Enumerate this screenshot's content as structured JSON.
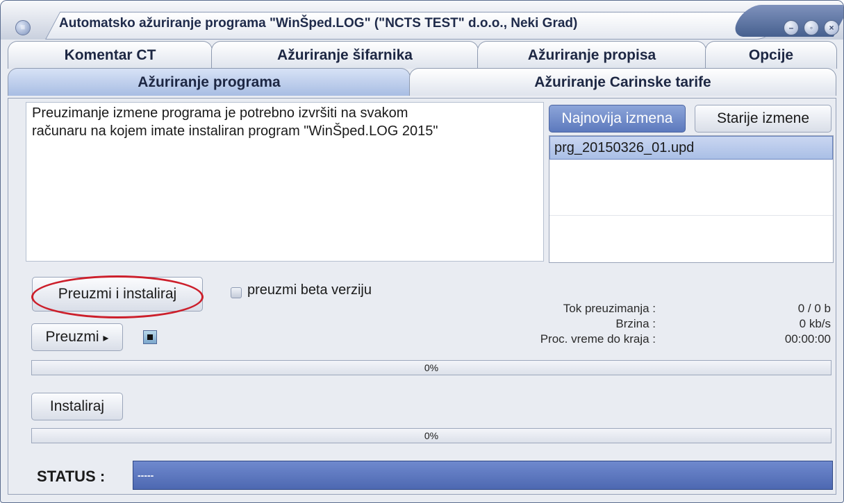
{
  "window": {
    "title": "Automatsko ažuriranje programa \"WinŠped.LOG\"  (\"NCTS TEST\" d.o.o., Neki Grad)",
    "accent": "#5a77bd"
  },
  "tabs": {
    "row1": [
      "Komentar CT",
      "Ažuriranje šifarnika",
      "Ažuriranje propisa",
      "Opcije"
    ],
    "row2": [
      "Ažuriranje programa",
      "Ažuriranje Carinske tarife"
    ],
    "active": "Ažuriranje programa"
  },
  "info": {
    "line1": "Preuzimanje izmene programa je potrebno izvršiti na svakom",
    "line2": "računaru na kojem imate instaliran program \"WinŠped.LOG 2015\""
  },
  "versions": {
    "latest_label": "Najnovija izmena",
    "older_label": "Starije izmene",
    "items": [
      "prg_20150326_01.upd"
    ]
  },
  "download": {
    "download_install_label": "Preuzmi i instaliraj",
    "beta_label": "preuzmi beta verziju",
    "beta_checked": false,
    "download_label": "Preuzmi",
    "download_arrow": "▸",
    "progress_label": "0%",
    "progress_value": 0
  },
  "stats": {
    "flow_label": "Tok preuzimanja :",
    "flow_value": "0 / 0 b",
    "speed_label": "Brzina :",
    "speed_value": "0 kb/s",
    "remaining_label": "Proc. vreme do kraja :",
    "remaining_value": "00:00:00"
  },
  "install": {
    "install_label": "Instaliraj",
    "progress_label": "0%",
    "progress_value": 0
  },
  "status": {
    "label": "STATUS :",
    "value": "-----"
  },
  "icons": [
    "menu-icon",
    "minimize-icon",
    "restore-icon",
    "close-icon",
    "stop-icon",
    "arrow-right-icon"
  ]
}
